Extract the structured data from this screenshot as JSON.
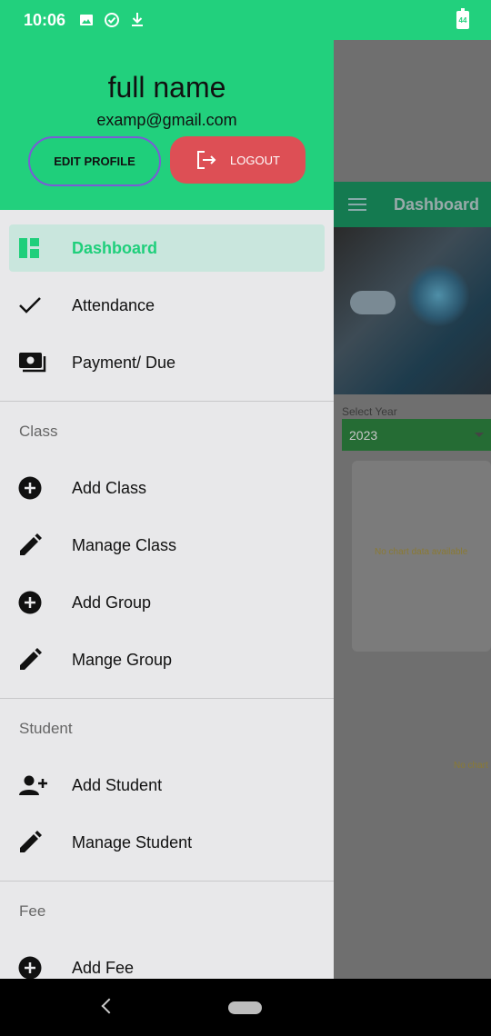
{
  "status_bar": {
    "time": "10:06",
    "icons": [
      "image-icon",
      "check-circle-icon",
      "download-icon"
    ],
    "battery": "44"
  },
  "background_app": {
    "toolbar_title": "Dashboard",
    "select_label": "Select Year",
    "select_value": "2023",
    "no_chart_text": "No chart data available",
    "no_chart_text_2": "No chart"
  },
  "drawer": {
    "header": {
      "name": "full name",
      "email": "examp@gmail.com",
      "edit_label": "EDIT PROFILE",
      "logout_label": "LOGOUT"
    },
    "items_main": [
      {
        "label": "Dashboard",
        "icon": "dashboard-icon",
        "active": true
      },
      {
        "label": "Attendance",
        "icon": "check-icon"
      },
      {
        "label": "Payment/ Due",
        "icon": "payment-icon"
      }
    ],
    "sections": [
      {
        "title": "Class",
        "items": [
          {
            "label": "Add Class",
            "icon": "add-circle-icon"
          },
          {
            "label": "Manage Class",
            "icon": "pencil-icon"
          },
          {
            "label": "Add Group",
            "icon": "add-circle-icon"
          },
          {
            "label": "Mange Group",
            "icon": "pencil-icon"
          }
        ]
      },
      {
        "title": "Student",
        "items": [
          {
            "label": "Add Student",
            "icon": "person-add-icon"
          },
          {
            "label": "Manage Student",
            "icon": "pencil-icon"
          }
        ]
      },
      {
        "title": "Fee",
        "items": [
          {
            "label": "Add Fee",
            "icon": "add-circle-icon"
          }
        ]
      }
    ]
  },
  "colors": {
    "accent": "#22d07d",
    "logout": "#dd4f55",
    "active_bg": "#c9e6dd"
  }
}
